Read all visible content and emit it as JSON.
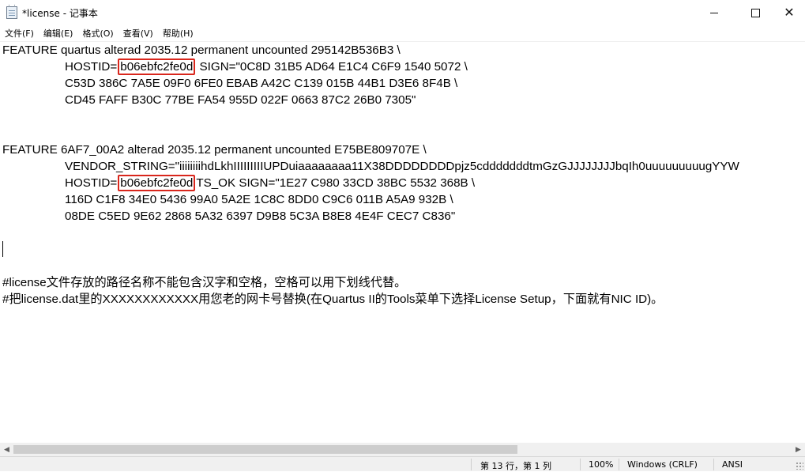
{
  "window": {
    "title": "*license - 记事本",
    "controls": {
      "minimize": "—",
      "maximize": "☐",
      "close": "✕"
    }
  },
  "menu": {
    "items": [
      "文件(F)",
      "编辑(E)",
      "格式(O)",
      "查看(V)",
      "帮助(H)"
    ]
  },
  "editor": {
    "lines": [
      "FEATURE quartus alterad 2035.12 permanent uncounted 295142B536B3 \\",
      "HOSTID=",
      "b06ebfc2fe0d",
      " SIGN=\"0C8D 31B5 AD64 E1C4 C6F9 1540 5072 \\",
      "C53D 386C 7A5E 09F0 6FE0 EBAB A42C C139 015B 44B1 D3E6 8F4B \\",
      "CD45 FAFF B30C 77BE FA54 955D 022F 0663 87C2 26B0 7305\"",
      "FEATURE 6AF7_00A2 alterad 2035.12 permanent uncounted E75BE809707E \\",
      "VENDOR_STRING=\"iiiiiiiihdLkhIIIIIIIIIUPDuiaaaaaaaa11X38DDDDDDDDpjz5cdddddddtmGzGJJJJJJJJbqIh0uuuuuuuuugYYW",
      "HOSTID=",
      "b06ebfc2fe0d",
      "TS_OK SIGN=\"1E27 C980 33CD 38BC 5532 368B \\",
      "116D C1F8 34E0 5436 99A0 5A2E 1C8C 8DD0 C9C6 011B A5A9 932B \\",
      "08DE C5ED 9E62 2868 5A32 6397 D9B8 5C3A B8E8 4E4F CEC7 C836\"",
      "#license文件存放的路径名称不能包含汉字和空格，空格可以用下划线代替。",
      "#把license.dat里的XXXXXXXXXXXX用您老的网卡号替换(在Quartus II的Tools菜单下选择License Setup，下面就有NIC ID)。"
    ],
    "highlight_color": "#d9261c"
  },
  "status": {
    "position": "第 13 行，第 1 列",
    "zoom": "100%",
    "line_ending": "Windows (CRLF)",
    "encoding": "ANSI"
  }
}
